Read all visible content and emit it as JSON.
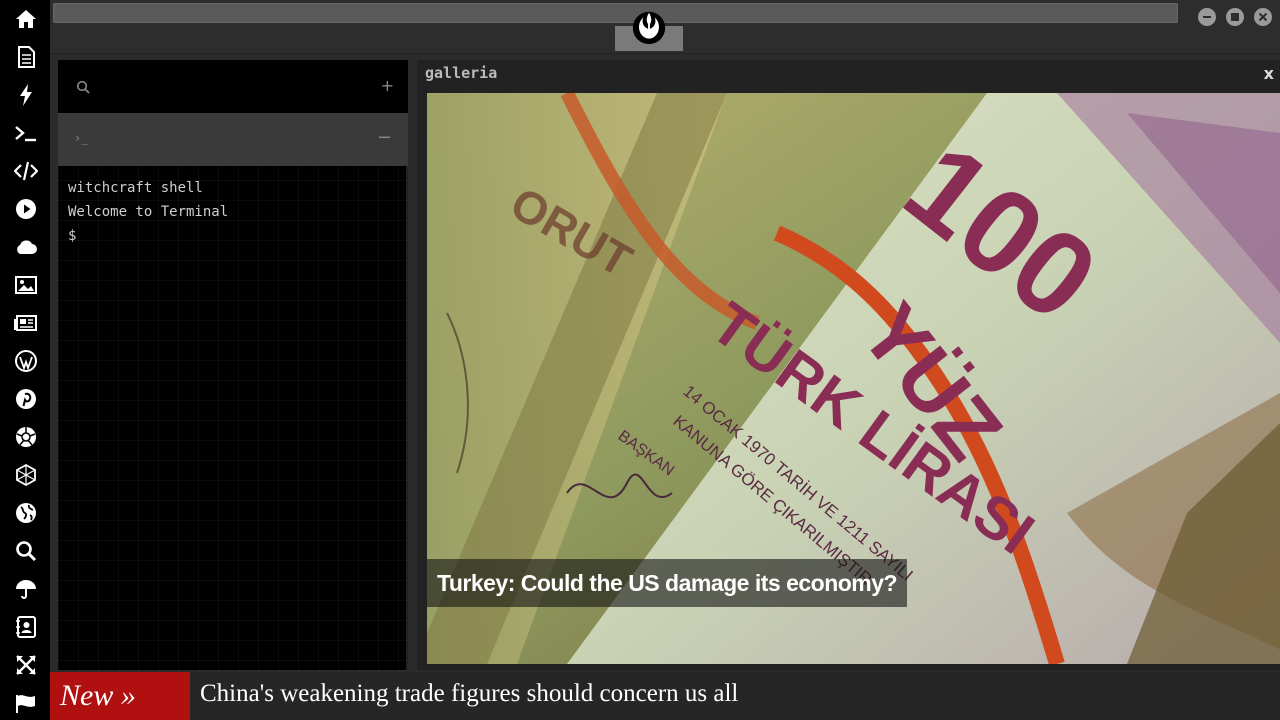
{
  "dock": {
    "items": [
      {
        "icon": "home-icon"
      },
      {
        "icon": "document-icon"
      },
      {
        "icon": "lightning-icon"
      },
      {
        "icon": "terminal-icon"
      },
      {
        "icon": "code-icon"
      },
      {
        "icon": "play-icon"
      },
      {
        "icon": "cloud-icon"
      },
      {
        "icon": "image-icon"
      },
      {
        "icon": "newspaper-icon"
      },
      {
        "icon": "wordpress-icon"
      },
      {
        "icon": "pinterest-icon"
      },
      {
        "icon": "aperture-icon"
      },
      {
        "icon": "globe-wire-icon"
      },
      {
        "icon": "globe-icon"
      },
      {
        "icon": "search-icon"
      },
      {
        "icon": "umbrella-icon"
      },
      {
        "icon": "contacts-icon"
      },
      {
        "icon": "expand-icon"
      },
      {
        "icon": "flag-icon"
      }
    ]
  },
  "topbar": {
    "logo_icon": "rebel-alliance-icon"
  },
  "terminal": {
    "plus_label": "+",
    "tab_prompt": "›_",
    "minus_label": "−",
    "lines": [
      "witchcraft shell",
      "Welcome to Terminal",
      "$"
    ]
  },
  "gallery": {
    "title": "galleria",
    "close_label": "x",
    "caption": "Turkey: Could the US damage its economy?",
    "banknote_text": {
      "denomination": "100",
      "word": "YÜZ",
      "country": "TÜRK LİRASI",
      "date_line": "14 OCAK 1970 TARİH VE 1211 SAYILI",
      "law_line": "KANUNA GÖRE ÇIKARILMIŞTIR",
      "signature_title": "BAŞKAN",
      "back_word": "ORUT"
    }
  },
  "ticker": {
    "badge": "New »",
    "headline": "China's weakening trade figures should concern us all"
  },
  "colors": {
    "accent_red": "#b01010",
    "dock_bg": "#000000",
    "panel_bg": "#2b2b2b"
  }
}
